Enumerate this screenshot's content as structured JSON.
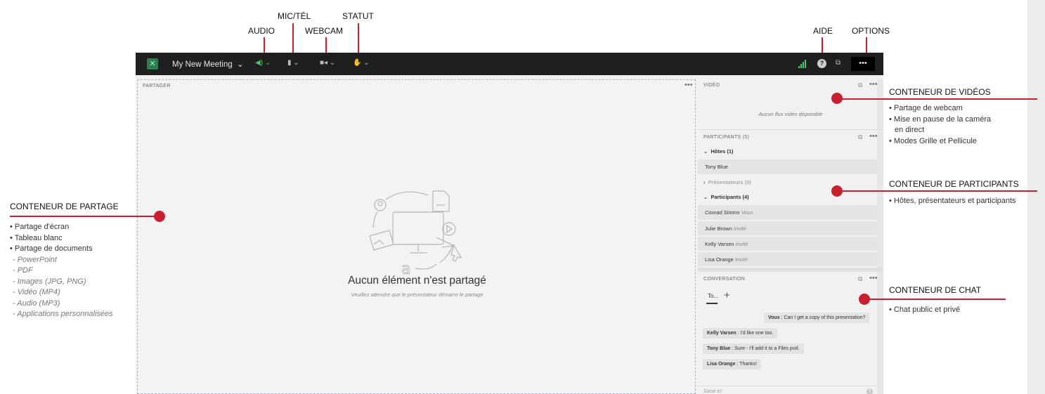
{
  "top_labels": {
    "audio": "AUDIO",
    "mic": "MIC/TÉL",
    "webcam": "WEBCAM",
    "statut": "STATUT",
    "aide": "AIDE",
    "options": "OPTIONS"
  },
  "toolbar": {
    "meeting_title": "My New Meeting",
    "options_label": "•••",
    "help_label": "?"
  },
  "share_pod": {
    "title": "PARTAGER",
    "menu": "•••",
    "empty_title": "Aucun élément n'est partagé",
    "empty_subtitle": "Veuillez attendre que le présentateur démarre le partage"
  },
  "video_pod": {
    "title": "VIDÉO",
    "empty": "Aucun flux vidéo disponible"
  },
  "participants_pod": {
    "title": "PARTICIPANTS",
    "count": "(5)",
    "hosts_group": "Hôtes (1)",
    "hosts": [
      {
        "name": "Tony Blue",
        "role": ""
      }
    ],
    "presenters_group": "Présentateurs (0)",
    "participants_group": "Participants (4)",
    "participants": [
      {
        "name": "Conrad Simms",
        "role": "Vous"
      },
      {
        "name": "Julie Brown",
        "role": "Invité"
      },
      {
        "name": "Kelly Varsen",
        "role": "Invité"
      },
      {
        "name": "Lisa Orange",
        "role": "Invité"
      }
    ]
  },
  "chat_pod": {
    "title": "CONVERSATION",
    "tab_label": "To...",
    "add_label": "+",
    "messages": [
      {
        "author": "Vous",
        "text": ": Can I get a copy of this presentation?"
      },
      {
        "author": "Kelly Varsen",
        "text": ": I'd like one too."
      },
      {
        "author": "Tony Blue",
        "text": ": Sure - I'll add it to a Files pod."
      },
      {
        "author": "Lisa Orange",
        "text": ": Thanks!"
      }
    ],
    "input_placeholder": "Saisir ici"
  },
  "annotations": {
    "share": {
      "title": "CONTENEUR DE PARTAGE",
      "items": [
        "• Partage d'écran",
        "• Tableau blanc",
        "• Partage de documents"
      ],
      "subitems": [
        "- PowerPoint",
        "- PDF",
        "- Images (JPG, PNG)",
        "- Vidéo (MP4)",
        "- Audio (MP3)",
        "- Applications personnalisées"
      ]
    },
    "video": {
      "title": "CONTENEUR DE VIDÉOS",
      "items": [
        "• Partage de webcam",
        "• Mise en pause de la caméra",
        "  en direct",
        "• Modes Grille et Pellicule"
      ]
    },
    "participants": {
      "title": "CONTENEUR DE PARTICIPANTS",
      "items": [
        "• Hôtes, présentateurs et participants"
      ]
    },
    "chat": {
      "title": "CONTENEUR DE CHAT",
      "items": [
        "• Chat public et privé"
      ]
    }
  },
  "colors": {
    "accent_red": "#c8202e",
    "toolbar_bg": "#1f1f1f",
    "green_active": "#4fc36e"
  }
}
